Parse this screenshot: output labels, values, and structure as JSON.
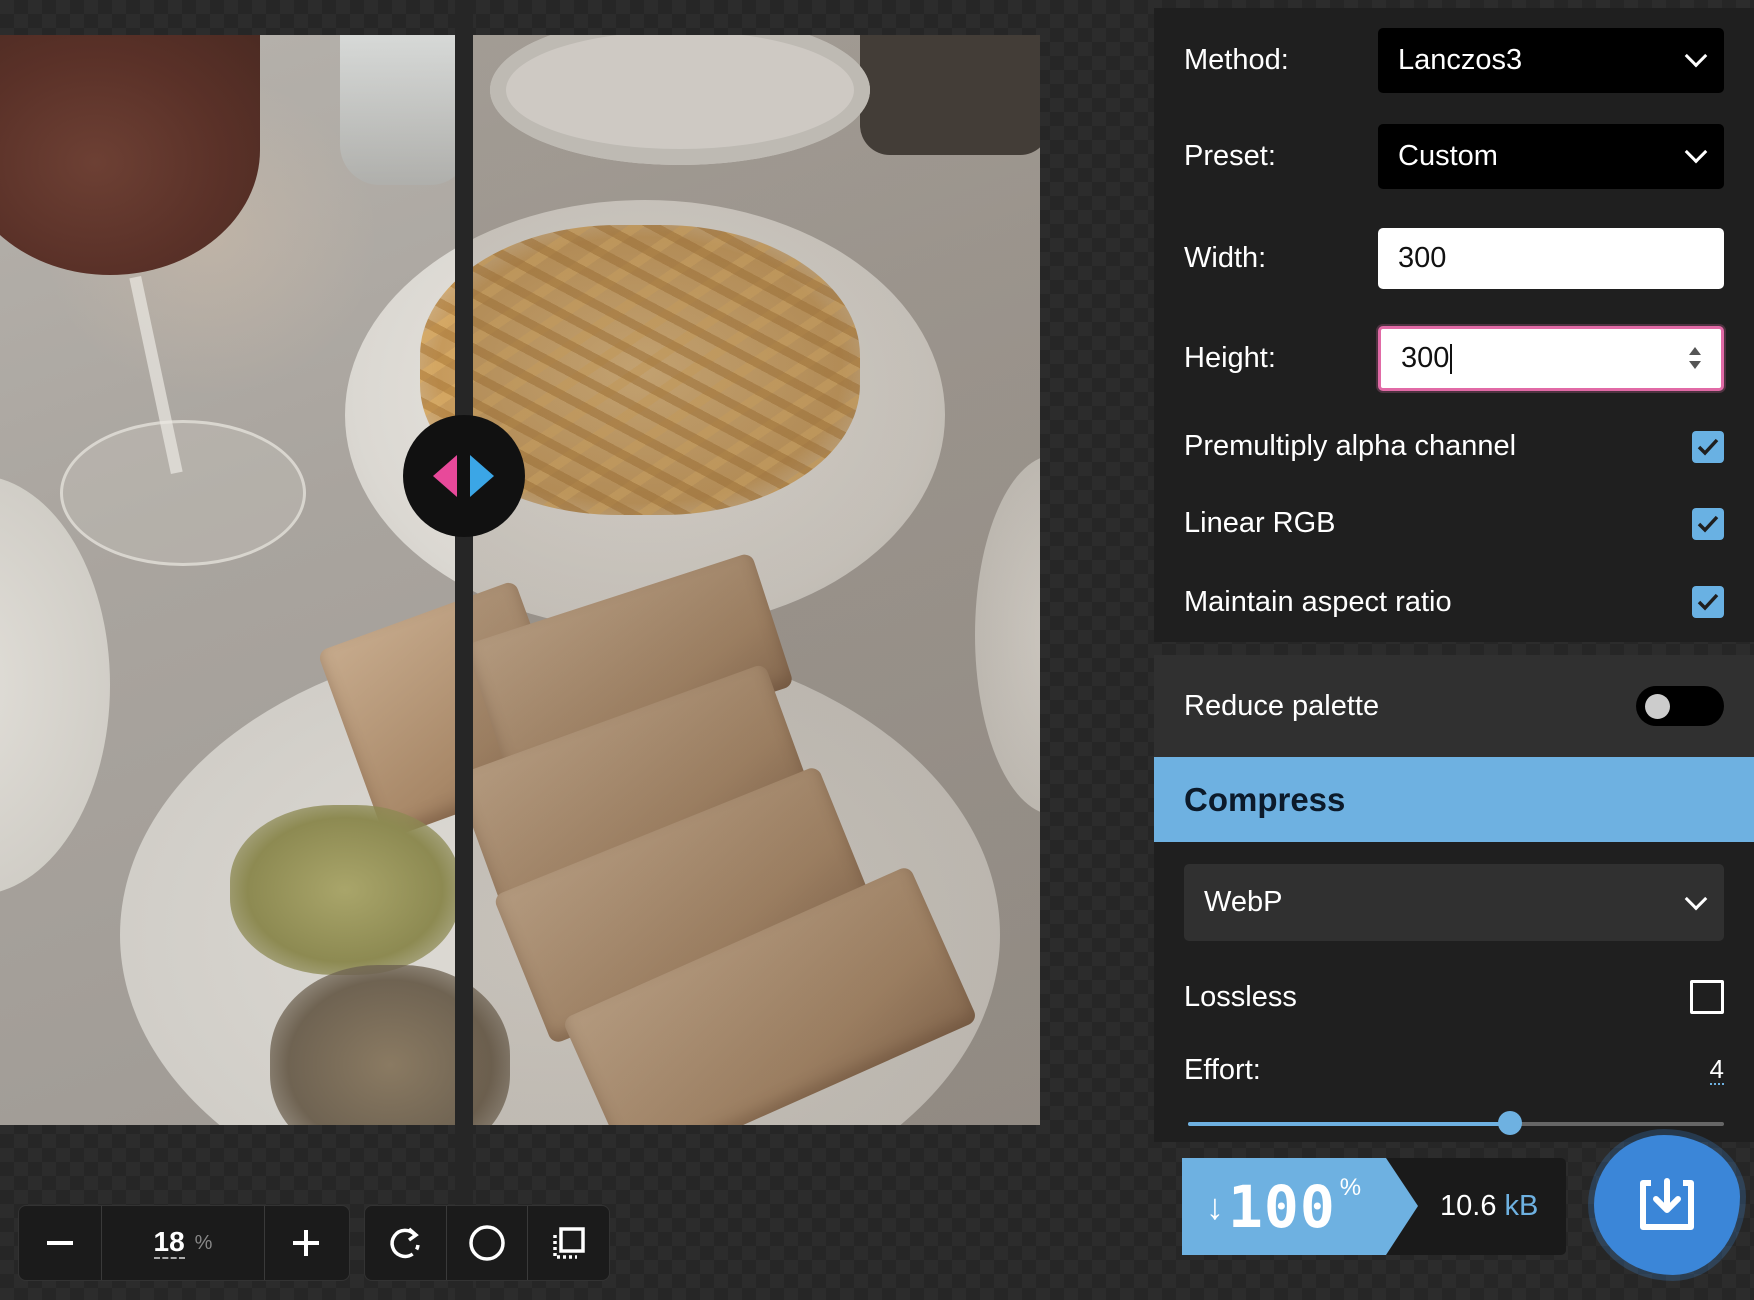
{
  "viewer": {
    "zoom_value": "18",
    "zoom_unit": "%",
    "zoom_out_label": "−",
    "zoom_in_label": "+"
  },
  "resize": {
    "method_label": "Method:",
    "method_value": "Lanczos3",
    "preset_label": "Preset:",
    "preset_value": "Custom",
    "width_label": "Width:",
    "width_value": "300",
    "height_label": "Height:",
    "height_value": "300",
    "premultiply_label": "Premultiply alpha channel",
    "premultiply_checked": true,
    "linear_rgb_label": "Linear RGB",
    "linear_rgb_checked": true,
    "aspect_label": "Maintain aspect ratio",
    "aspect_checked": true
  },
  "palette": {
    "reduce_label": "Reduce palette",
    "reduce_on": false
  },
  "compress": {
    "header": "Compress",
    "format_value": "WebP",
    "lossless_label": "Lossless",
    "lossless_checked": false,
    "effort_label": "Effort:",
    "effort_value": "4",
    "effort_fraction": 0.6
  },
  "result": {
    "arrow": "↓",
    "savings_value": "100",
    "savings_unit": "%",
    "size_value": "10.6",
    "size_unit": "kB"
  },
  "colors": {
    "accent_blue": "#6eb1e1",
    "accent_pink": "#e16aa6",
    "download_blue": "#3b86d8"
  },
  "icons": [
    "minus-icon",
    "plus-icon",
    "rotate-icon",
    "circle-icon",
    "crop-icon",
    "download-icon",
    "check-icon",
    "chevron-down-icon"
  ]
}
